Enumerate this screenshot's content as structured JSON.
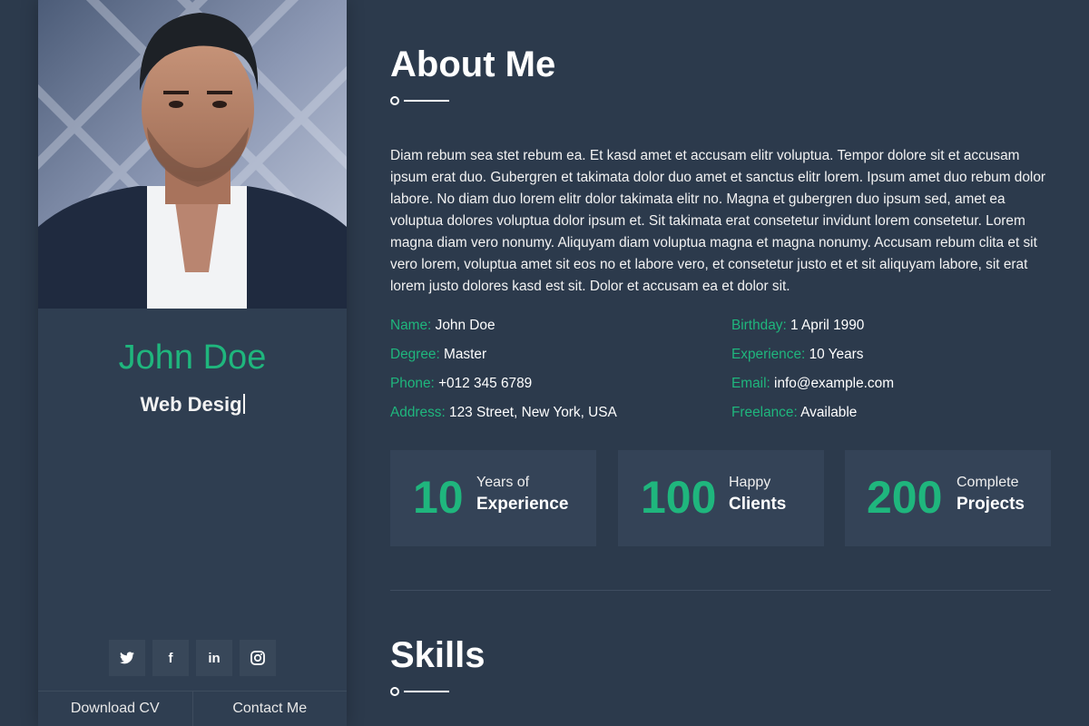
{
  "colors": {
    "accent": "#1fb67d",
    "background": "#2c3a4c",
    "sidebar": "#2f3e51",
    "card": "#344357"
  },
  "profile": {
    "name": "John Doe",
    "role_typing": "Web Desig",
    "photo_icon": "portrait-photo",
    "socials": [
      {
        "name": "twitter-icon",
        "glyph": "🐦"
      },
      {
        "name": "facebook-icon",
        "glyph": "f"
      },
      {
        "name": "linkedin-icon",
        "glyph": "in"
      },
      {
        "name": "instagram-icon",
        "glyph": "◎"
      }
    ],
    "download_cv": "Download CV",
    "contact_me": "Contact Me"
  },
  "about": {
    "title": "About Me",
    "bio": "Diam rebum sea stet rebum ea. Et kasd amet et accusam elitr voluptua. Tempor dolore sit et accusam ipsum erat duo. Gubergren et takimata dolor duo amet et sanctus elitr lorem. Ipsum amet duo rebum dolor labore. No diam duo lorem elitr dolor takimata elitr no. Magna et gubergren duo ipsum sed, amet ea voluptua dolores voluptua dolor ipsum et. Sit takimata erat consetetur invidunt lorem consetetur. Lorem magna diam vero nonumy. Aliquyam diam voluptua magna et magna nonumy. Accusam rebum clita et sit vero lorem, voluptua amet sit eos no et labore vero, et consetetur justo et et sit aliquyam labore, sit erat lorem justo dolores kasd est sit. Dolor et accusam ea et dolor sit.",
    "info": [
      {
        "label": "Name:",
        "value": "John Doe"
      },
      {
        "label": "Birthday:",
        "value": "1 April 1990"
      },
      {
        "label": "Degree:",
        "value": "Master"
      },
      {
        "label": "Experience:",
        "value": "10 Years"
      },
      {
        "label": "Phone:",
        "value": "+012 345 6789"
      },
      {
        "label": "Email:",
        "value": "info@example.com"
      },
      {
        "label": "Address:",
        "value": "123 Street, New York, USA"
      },
      {
        "label": "Freelance:",
        "value": "Available"
      }
    ],
    "stats": [
      {
        "number": "10",
        "small": "Years of",
        "big": "Experience"
      },
      {
        "number": "100",
        "small": "Happy",
        "big": "Clients"
      },
      {
        "number": "200",
        "small": "Complete",
        "big": "Projects"
      }
    ]
  },
  "skills": {
    "title": "Skills"
  }
}
